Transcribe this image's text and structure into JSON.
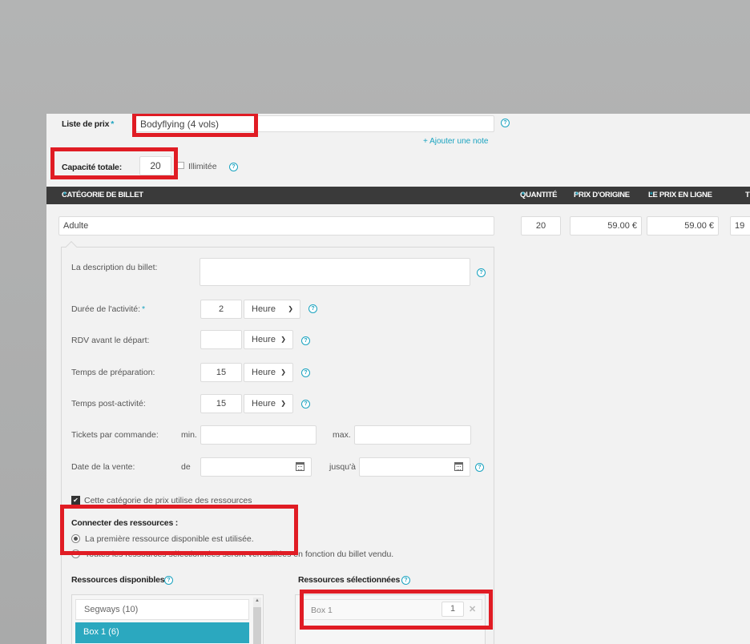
{
  "price_list": {
    "label": "Liste de prix",
    "value": "Bodyflying (4 vols)",
    "add_note": "+ Ajouter une note"
  },
  "capacity": {
    "label": "Capacité totale:",
    "value": "20",
    "unlimited_label": "Illimitée"
  },
  "table_header": {
    "category": "CATÉGORIE DE BILLET",
    "quantity": "QUANTITÉ",
    "original_price": "PRIX D'ORIGINE",
    "online_price": "LE PRIX EN LIGNE",
    "next_col": "T"
  },
  "ticket": {
    "category": "Adulte",
    "quantity": "20",
    "original_price": "59.00 €",
    "online_price": "59.00 €",
    "next_value": "19"
  },
  "details": {
    "description_label": "La description du billet:",
    "duration": {
      "label": "Durée de l'activité:",
      "value": "2",
      "unit": "Heure"
    },
    "rdv": {
      "label": "RDV avant le départ:",
      "value": "",
      "unit": "Heure"
    },
    "prep": {
      "label": "Temps de préparation:",
      "value": "15",
      "unit": "Heure"
    },
    "post": {
      "label": "Temps post-activité:",
      "value": "15",
      "unit": "Heure"
    },
    "tickets_per_order": {
      "label": "Tickets par commande:",
      "min": "min.",
      "max": "max."
    },
    "sale_date": {
      "label": "Date de la vente:",
      "from": "de",
      "to": "jusqu'à"
    }
  },
  "resources": {
    "uses_resources_label": "Cette catégorie de prix utilise des ressources",
    "connect_title": "Connecter des ressources :",
    "option1": "La première ressource disponible est utilisée.",
    "option2": "Toutes les ressources sélectionnées seront verrouillées en fonction du billet vendu.",
    "available_title": "Ressources disponibles",
    "selected_title": "Ressources sélectionnées",
    "available": [
      "Segways (10)",
      "Box 1 (6)"
    ],
    "selected": [
      {
        "name": "Box 1",
        "qty": "1"
      }
    ]
  },
  "colors": {
    "accent": "#1aa3c0",
    "highlight": "#e01c24",
    "header_bg": "#3a3a3a"
  }
}
